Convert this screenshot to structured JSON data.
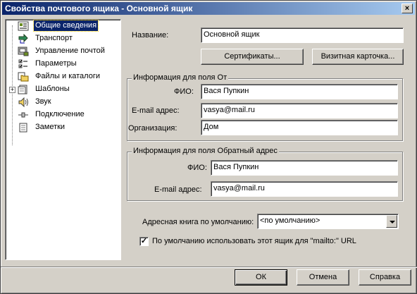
{
  "window": {
    "title": "Свойства почтового ящика - Основной ящик",
    "close_label": "×"
  },
  "tree": {
    "expander_label": "+",
    "items": [
      {
        "label": "Общие сведения",
        "icon": "general-info-icon",
        "selected": true
      },
      {
        "label": "Транспорт",
        "icon": "transport-icon"
      },
      {
        "label": "Управление почтой",
        "icon": "mail-management-icon"
      },
      {
        "label": "Параметры",
        "icon": "parameters-icon"
      },
      {
        "label": "Файлы и каталоги",
        "icon": "folder-icon"
      },
      {
        "label": "Шаблоны",
        "icon": "templates-icon",
        "expandable": true
      },
      {
        "label": "Звук",
        "icon": "speaker-icon"
      },
      {
        "label": "Подключение",
        "icon": "connection-icon"
      },
      {
        "label": "Заметки",
        "icon": "notes-icon"
      }
    ]
  },
  "name": {
    "label": "Название:",
    "value": "Основной ящик"
  },
  "buttons": {
    "certificates": "Сертификаты...",
    "business_card": "Визитная карточка...",
    "ok": "ОК",
    "cancel": "Отмена",
    "help": "Справка"
  },
  "from_group": {
    "title": "Информация для поля От",
    "fio_label": "ФИО:",
    "fio_value": "Вася Пупкин",
    "email_label": "E-mail адрес:",
    "email_value": "vasya@mail.ru",
    "org_label": "Организация:",
    "org_value": "Дом"
  },
  "reply_group": {
    "title": "Информация для поля Обратный адрес",
    "fio_label": "ФИО:",
    "fio_value": "Вася Пупкин",
    "email_label": "E-mail адрес:",
    "email_value": "vasya@mail.ru"
  },
  "address_book": {
    "label": "Адресная книга по умолчанию:",
    "value": "<по умолчанию>"
  },
  "mailto": {
    "label": "По умолчанию использовать этот ящик для \"mailto:\" URL",
    "checked": true,
    "check_mark": "✓"
  }
}
